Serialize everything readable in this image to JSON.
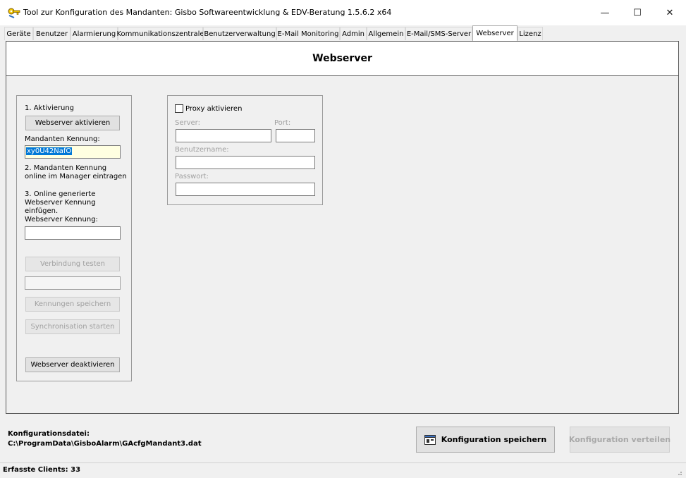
{
  "window": {
    "title": "Tool zur Konfiguration des Mandanten: Gisbo Softwareentwicklung & EDV-Beratung 1.5.6.2 x64",
    "icon": "key-icon",
    "controls": {
      "minimize": "—",
      "maximize": "☐",
      "close": "✕"
    }
  },
  "tabs": [
    {
      "label": "Geräte",
      "active": false
    },
    {
      "label": "Benutzer",
      "active": false
    },
    {
      "label": "Alarmierung",
      "active": false
    },
    {
      "label": "Kommunikationszentrale",
      "active": false
    },
    {
      "label": "Benutzerverwaltung",
      "active": false
    },
    {
      "label": "E-Mail Monitoring",
      "active": false
    },
    {
      "label": "Admin",
      "active": false
    },
    {
      "label": "Allgemein",
      "active": false
    },
    {
      "label": "E-Mail/SMS-Server",
      "active": false
    },
    {
      "label": "Webserver",
      "active": true
    },
    {
      "label": "Lizenz",
      "active": false
    }
  ],
  "page": {
    "title": "Webserver"
  },
  "activation": {
    "step1": "1. Aktivierung",
    "activate_button": "Webserver aktivieren",
    "tenant_id_label": "Mandanten Kennung:",
    "tenant_id_value": "xy0U42NafO",
    "step2": "2. Mandanten Kennung online im Manager eintragen",
    "step3": "3. Online generierte Webserver Kennung einfügen.",
    "webserver_id_label": "Webserver Kennung:",
    "webserver_id_value": "",
    "test_button": "Verbindung testen",
    "test_result": "",
    "save_ids_button": "Kennungen speichern",
    "sync_button": "Synchronisation starten",
    "deactivate_button": "Webserver deaktivieren"
  },
  "proxy": {
    "enable_label": "Proxy aktivieren",
    "enabled": false,
    "server_label": "Server:",
    "server_value": "",
    "port_label": "Port:",
    "port_value": "",
    "username_label": "Benutzername:",
    "username_value": "",
    "password_label": "Passwort:",
    "password_value": ""
  },
  "footer": {
    "config_file_label": "Konfigurationsdatei:",
    "config_file_path": "C:\\ProgramData\\GisboAlarm\\GAcfgMandant3.dat",
    "save_button": "Konfiguration speichern",
    "distribute_button": "Konfiguration verteilen"
  },
  "status": {
    "clients": "Erfasste Clients: 33"
  },
  "colors": {
    "selection": "#0078d7",
    "highlight_field": "#ffffe1",
    "disabled_text": "#a0a0a0"
  }
}
